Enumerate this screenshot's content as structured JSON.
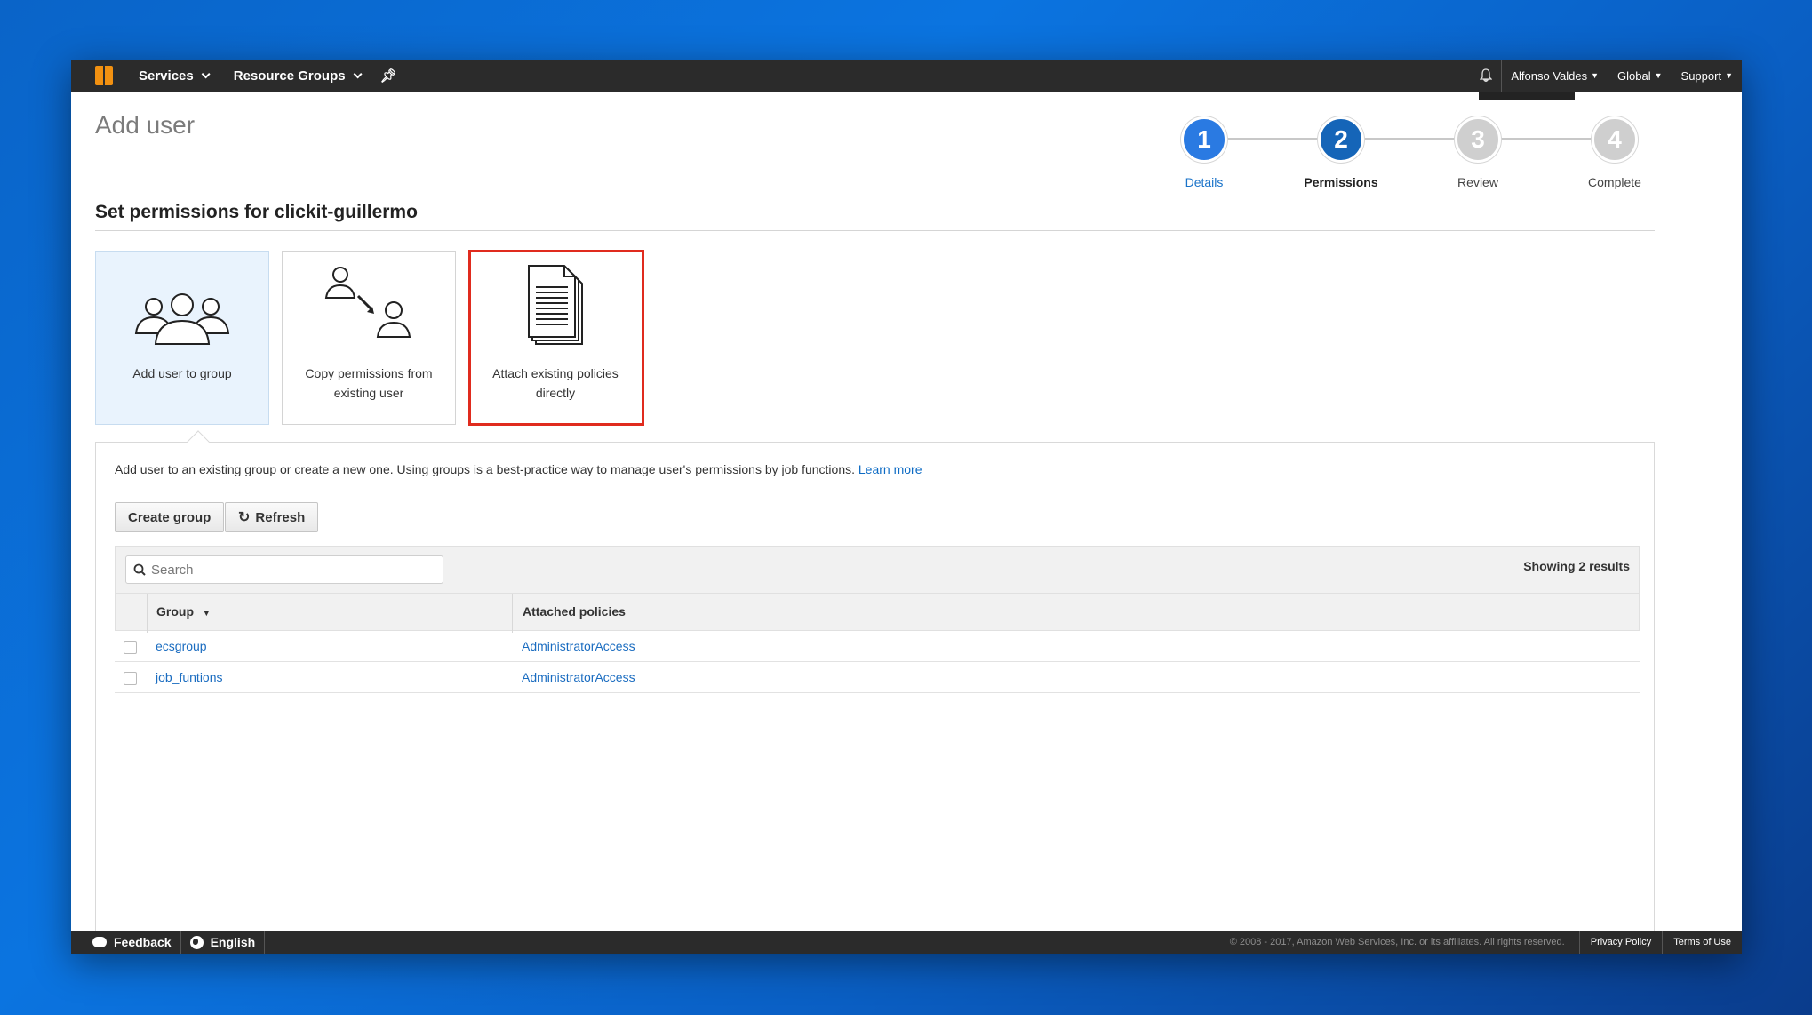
{
  "topnav": {
    "logo_icon": "aws-cube-icon",
    "services_label": "Services",
    "resource_groups_label": "Resource Groups",
    "user_label": "Alfonso Valdes",
    "region_label": "Global",
    "support_label": "Support"
  },
  "page": {
    "title": "Add user",
    "section_title": "Set permissions for clickit-guillermo"
  },
  "stepper": {
    "steps": [
      {
        "number": "1",
        "label": "Details"
      },
      {
        "number": "2",
        "label": "Permissions"
      },
      {
        "number": "3",
        "label": "Review"
      },
      {
        "number": "4",
        "label": "Complete"
      }
    ]
  },
  "options": [
    {
      "label": "Add user to group",
      "icon": "user-group-icon"
    },
    {
      "label": "Copy permissions from existing user",
      "icon": "copy-permissions-icon"
    },
    {
      "label": "Attach existing policies directly",
      "icon": "document-stack-icon"
    }
  ],
  "panel": {
    "description": "Add user to an existing group or create a new one. Using groups is a best-practice way to manage user's permissions by job functions.",
    "learn_more": "Learn more",
    "create_group_label": "Create group",
    "refresh_label": "Refresh",
    "search_placeholder": "Search",
    "results_text": "Showing 2 results",
    "columns": [
      "Group",
      "Attached policies"
    ],
    "rows": [
      {
        "group": "ecsgroup",
        "policy": "AdministratorAccess"
      },
      {
        "group": "job_funtions",
        "policy": "AdministratorAccess"
      }
    ]
  },
  "footer": {
    "feedback_label": "Feedback",
    "language_label": "English",
    "copyright": "© 2008 - 2017, Amazon Web Services, Inc. or its affiliates. All rights reserved.",
    "privacy_label": "Privacy Policy",
    "terms_label": "Terms of Use"
  },
  "colors": {
    "nav_bg": "#2b2b2b",
    "accent_blue": "#1565b8",
    "highlight_red": "#e02b1e",
    "link_blue": "#1a6cc0"
  }
}
